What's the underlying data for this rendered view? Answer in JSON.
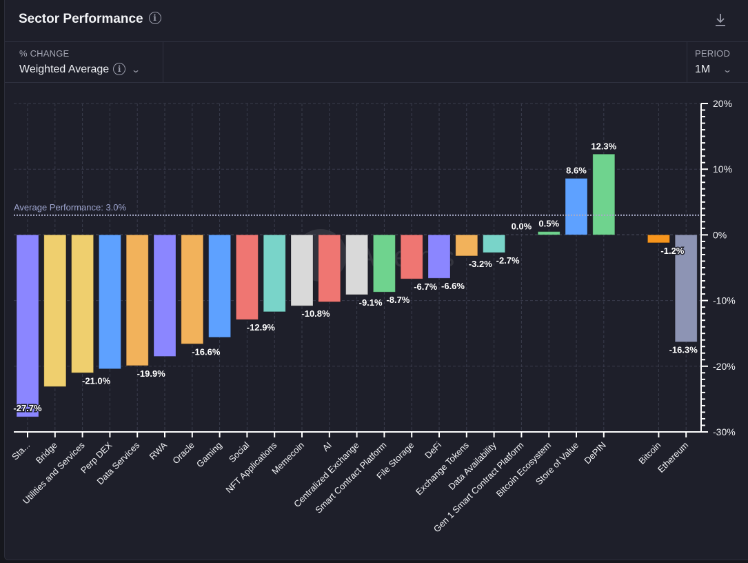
{
  "header": {
    "title": "Sector Performance",
    "info_icon": "info-icon",
    "download_icon": "download-icon"
  },
  "controls": {
    "metric": {
      "label": "% CHANGE",
      "value": "Weighted Average",
      "info_icon": "info-icon",
      "chevron": "chevron-down-icon"
    },
    "period": {
      "label": "PERIOD",
      "value": "1M",
      "chevron": "chevron-down-icon"
    }
  },
  "watermark": "Artemis",
  "chart_data": {
    "type": "bar",
    "title": "Sector Performance",
    "xlabel": "",
    "ylabel": "% Change",
    "ylim": [
      -30,
      20
    ],
    "yticks": [
      20,
      10,
      0,
      -10,
      -20,
      -30
    ],
    "ytick_labels": [
      "20%",
      "10%",
      "0%",
      "-10%",
      "-20%",
      "-30%"
    ],
    "y_minor_step": 1,
    "grid": true,
    "legend": "none",
    "reference_line": {
      "label": "Average Performance: 3.0%",
      "value": 3.0
    },
    "categories": [
      "Sta...",
      "Bridge",
      "Utilities and Services",
      "Perp DEX",
      "Data Services",
      "RWA",
      "Oracle",
      "Gaming",
      "Social",
      "NFT Applications",
      "Memecoin",
      "AI",
      "Centralized Exchange",
      "Smart Contract Platform",
      "File Storage",
      "DeFi",
      "Exchange Tokens",
      "Data Availability",
      "Gen 1 Smart Contract Platform",
      "Bitcoin Ecosystem",
      "Store of Value",
      "DePIN",
      "",
      "Bitcoin",
      "Ethereum"
    ],
    "values": [
      -27.7,
      -23.1,
      -21.0,
      -20.4,
      -19.9,
      -18.5,
      -16.6,
      -15.6,
      -12.9,
      -11.7,
      -10.8,
      -10.2,
      -9.1,
      -8.7,
      -6.7,
      -6.6,
      -3.2,
      -2.7,
      0.0,
      0.5,
      8.6,
      12.3,
      null,
      -1.2,
      -16.3
    ],
    "data_labels": [
      "-27.7%",
      null,
      "-21.0%",
      null,
      "-19.9%",
      null,
      "-16.6%",
      null,
      "-12.9%",
      null,
      "-10.8%",
      null,
      "-9.1%",
      "-8.7%",
      "-6.7%",
      "-6.6%",
      "-3.2%",
      "-2.7%",
      "0.0%",
      "0.5%",
      "8.6%",
      "12.3%",
      null,
      "-1.2%",
      "-16.3%"
    ],
    "colors": [
      "#8b86ff",
      "#efcf6e",
      "#efcf6e",
      "#5ea1ff",
      "#f2b25b",
      "#8b86ff",
      "#f2b25b",
      "#5ea1ff",
      "#ef7672",
      "#79d4c9",
      "#d9d9d9",
      "#ef7672",
      "#d9d9d9",
      "#6fd38e",
      "#ef7672",
      "#8b86ff",
      "#f2b25b",
      "#79d4c9",
      "#6fd38e",
      "#6fd38e",
      "#5ea1ff",
      "#6fd38e",
      null,
      "#f7951d",
      "#8d94b4"
    ]
  }
}
